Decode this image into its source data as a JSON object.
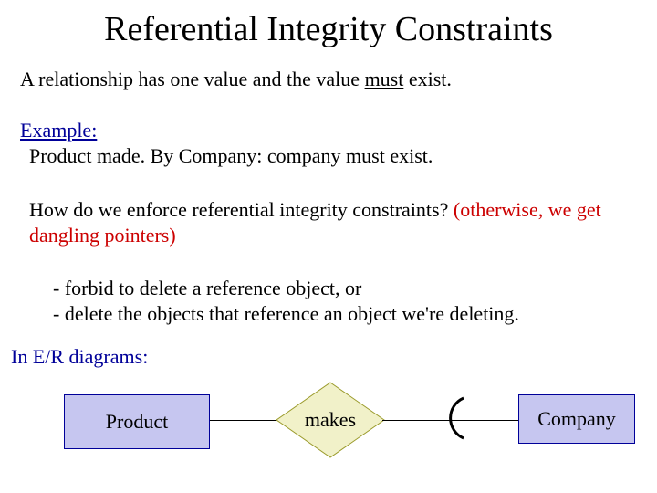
{
  "title": "Referential Integrity Constraints",
  "line1_a": "A relationship has one value and the value ",
  "line1_u": "must",
  "line1_b": " exist.",
  "example_label": "Example:",
  "example_text": "Product  made. By  Company: company must exist.",
  "question_a": "How do we enforce referential integrity constraints? ",
  "question_b": "(otherwise, we get dangling pointers)",
  "bullet1": "- forbid to delete a reference object, or",
  "bullet2": "- delete the objects that reference an object we're deleting.",
  "er_label": "In E/R diagrams:",
  "diagram": {
    "left_entity": "Product",
    "relation": "makes",
    "right_entity": "Company"
  }
}
